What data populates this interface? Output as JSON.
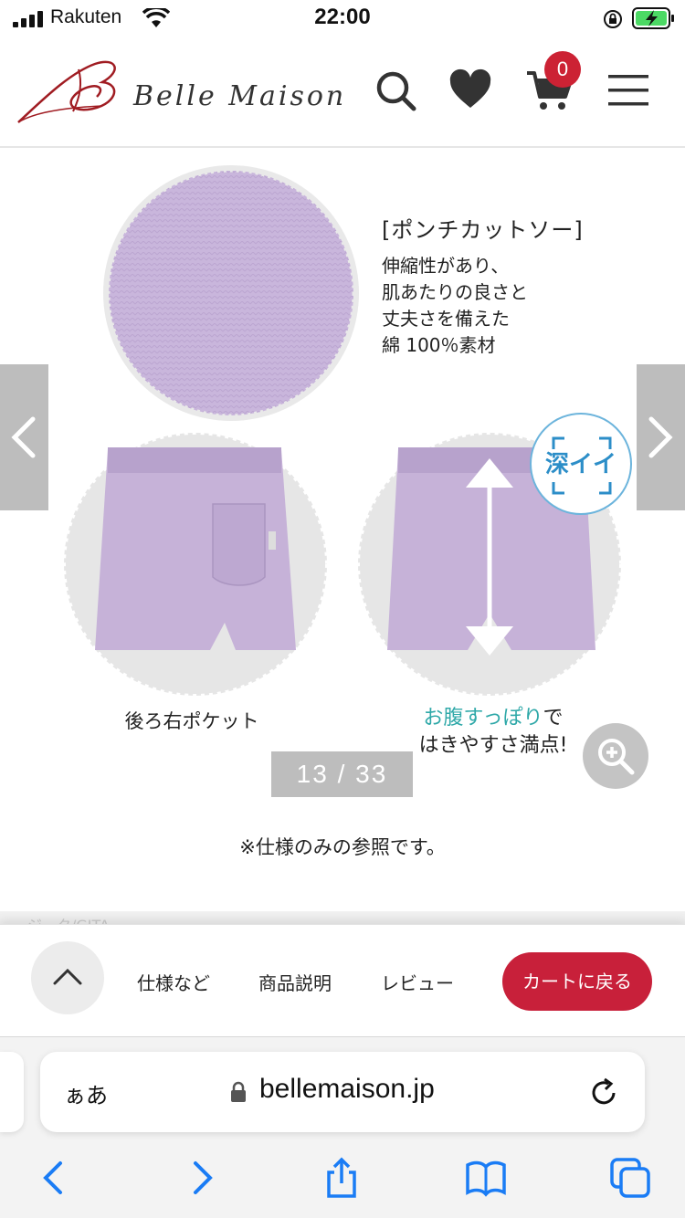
{
  "status_bar": {
    "carrier": "Rakuten",
    "time": "22:00"
  },
  "header": {
    "brand": "Belle Maison",
    "icons": [
      "search-icon",
      "heart-icon",
      "cart-icon",
      "hamburger-menu-icon"
    ],
    "cart_count": "0",
    "colors": {
      "brand": "#a01c22",
      "badge": "#cc2234"
    }
  },
  "gallery": {
    "feature_title": "[ポンチカットソー]",
    "feature_desc": "伸縮性があり、\n肌あたりの良さと\n丈夫さを備えた\n綿 100％素材",
    "badge_text": "深イイ",
    "caption_back": "後ろ右ポケット",
    "caption_front_highlight": "お腹すっぽり",
    "caption_front_rest": "で",
    "caption_front_line2": "はきやすさ満点!",
    "counter": "13 / 33",
    "colors": {
      "fabric": "#c9b6dc",
      "highlight": "#2ea8a8"
    }
  },
  "note": "※仕様のみの参照です。",
  "peek_text": "ジ…ク/GITA",
  "tabbar": {
    "spec": "仕様など",
    "description": "商品説明",
    "review": "レビュー",
    "cart_return": "カートに戻る",
    "colors": {
      "cta": "#c8203a"
    }
  },
  "safari": {
    "aa": "ぁあ",
    "url": "bellemaison.jp",
    "icons": [
      "back-icon",
      "forward-icon",
      "share-icon",
      "bookmarks-icon",
      "tabs-icon"
    ]
  }
}
